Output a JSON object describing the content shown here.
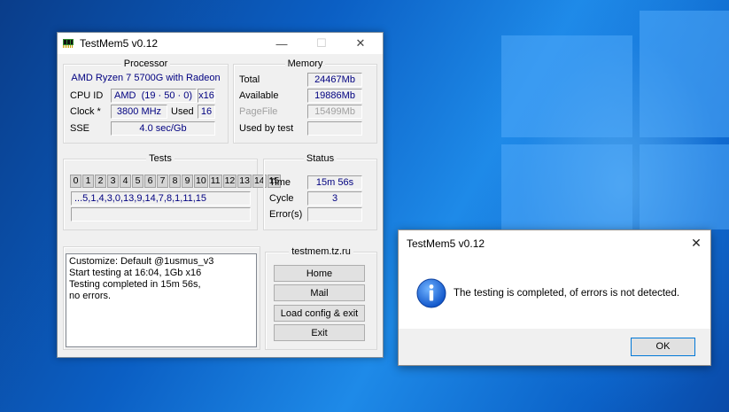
{
  "main_window": {
    "title": "TestMem5 v0.12",
    "controls": {
      "minimize": "—",
      "maximize": "☐",
      "close": "✕"
    }
  },
  "processor": {
    "title": "Processor",
    "name": "AMD Ryzen 7 5700G with Radeon",
    "cpu_id_label": "CPU ID",
    "vendor": "AMD",
    "cpu_id": "(19 · 50 · 0)",
    "threads": "x16",
    "clock_label": "Clock *",
    "clock": "3800 MHz",
    "used_label": "Used",
    "used": "16",
    "sse_label": "SSE",
    "sse": "4.0 sec/Gb"
  },
  "memory": {
    "title": "Memory",
    "total_label": "Total",
    "total": "24467Mb",
    "available_label": "Available",
    "available": "19886Mb",
    "pagefile_label": "PageFile",
    "pagefile": "15499Mb",
    "used_by_test_label": "Used by test",
    "used_by_test": ""
  },
  "tests": {
    "title": "Tests",
    "cells": [
      "0",
      "1",
      "2",
      "3",
      "4",
      "5",
      "6",
      "7",
      "8",
      "9",
      "10",
      "11",
      "12",
      "13",
      "14",
      "15"
    ],
    "sequence": "...5,1,4,3,0,13,9,14,7,8,1,11,15",
    "progress": ""
  },
  "status": {
    "title": "Status",
    "time_label": "Time",
    "time": "15m 56s",
    "cycle_label": "Cycle",
    "cycle": "3",
    "errors_label": "Error(s)",
    "errors": ""
  },
  "log": [
    "Customize: Default @1usmus_v3",
    "Start testing at 16:04, 1Gb x16",
    "Testing completed in 15m 56s,",
    "no errors."
  ],
  "links": {
    "title": "testmem.tz.ru",
    "home": "Home",
    "mail": "Mail",
    "load_config": "Load config & exit",
    "exit": "Exit"
  },
  "dialog": {
    "title": "TestMem5 v0.12",
    "close": "✕",
    "icon": "info-icon",
    "message": "The testing is completed, of errors is not detected.",
    "ok": "OK"
  },
  "colors": {
    "value_text": "#000080",
    "desktop": "#0b5fc4",
    "accent": "#0078d7"
  }
}
